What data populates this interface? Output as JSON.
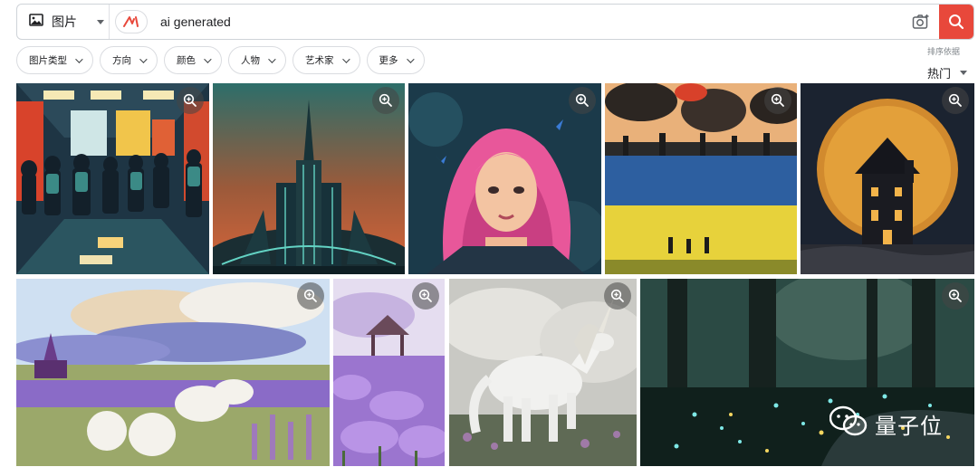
{
  "search": {
    "type_label": "图片",
    "query": "ai generated",
    "type_icon": "image-icon",
    "brand_icon": "ai-brand-logo",
    "camera_icon": "camera-search-icon",
    "submit_icon": "search-icon",
    "accent": "#e8483b"
  },
  "filters": [
    {
      "label": "图片类型"
    },
    {
      "label": "方向"
    },
    {
      "label": "颜色"
    },
    {
      "label": "人物"
    },
    {
      "label": "艺术家"
    },
    {
      "label": "更多"
    }
  ],
  "sort": {
    "label": "排序依据",
    "value": "热门"
  },
  "results": [
    {
      "subject": "students-hallway"
    },
    {
      "subject": "art-deco-tower"
    },
    {
      "subject": "pink-hair-girl"
    },
    {
      "subject": "ukraine-flag-field"
    },
    {
      "subject": "haunted-house-moon"
    },
    {
      "subject": "lavender-field-watercolor"
    },
    {
      "subject": "lavender-gazebo"
    },
    {
      "subject": "white-unicorn"
    },
    {
      "subject": "glowing-forest"
    }
  ],
  "watermark": {
    "text": "量子位"
  }
}
